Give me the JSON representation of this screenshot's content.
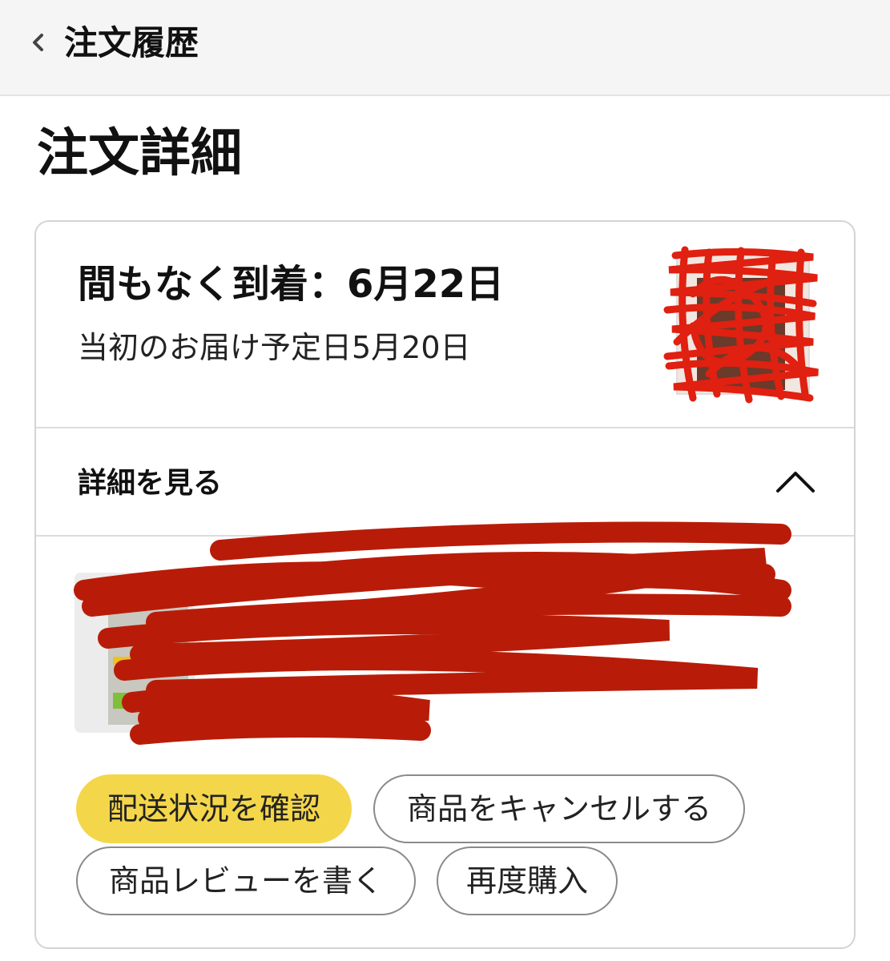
{
  "header": {
    "back_icon": "chevron-left-icon",
    "title": "注文履歴"
  },
  "page": {
    "title": "注文詳細"
  },
  "shipment": {
    "arrival_title": "間もなく到着：6月22日",
    "original_date": "当初のお届け予定日5月20日"
  },
  "details": {
    "label": "詳細を見る",
    "toggle_icon": "chevron-up-icon"
  },
  "actions": {
    "track": "配送状況を確認",
    "cancel": "商品をキャンセルする",
    "review": "商品レビューを書く",
    "rebuy": "再度購入"
  },
  "colors": {
    "accent": "#f4d64a",
    "redaction": "#c01808",
    "border": "#d4d4d4"
  }
}
